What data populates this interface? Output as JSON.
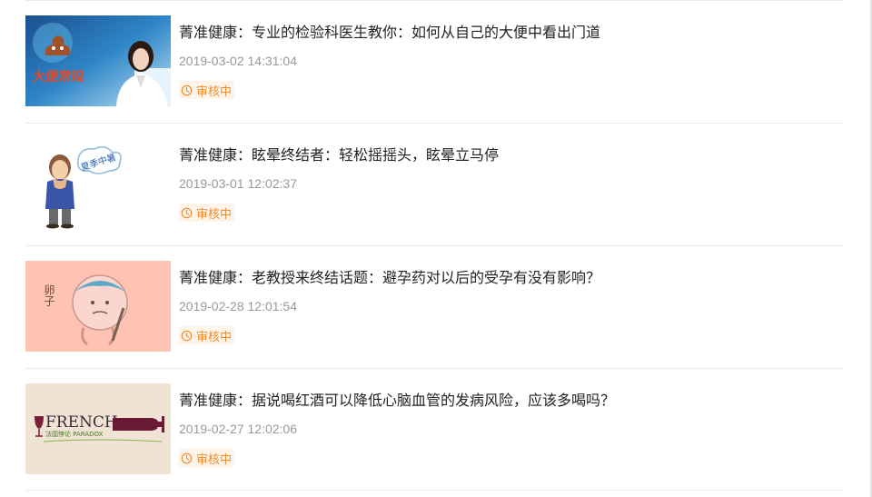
{
  "items": [
    {
      "thumb_text": "大便常规",
      "title": "菁准健康：专业的检验科医生教你：如何从自己的大便中看出门道",
      "date": "2019-03-02 14:31:04",
      "status": "审核中"
    },
    {
      "thumb_text": "夏季中暑",
      "title": "菁准健康：眩晕终结者：轻松摇摇头，眩晕立马停",
      "date": "2019-03-01 12:02:37",
      "status": "审核中"
    },
    {
      "thumb_text": "卵子",
      "title": "菁准健康：老教授来终结话题：避孕药对以后的受孕有没有影响？",
      "date": "2019-02-28 12:01:54",
      "status": "审核中"
    },
    {
      "thumb_text": "FRENCH",
      "thumb_subtext": "法国悖论 PARADOX",
      "title": "菁准健康：据说喝红酒可以降低心脑血管的发病风险，应该多喝吗？",
      "date": "2019-02-27 12:02:06",
      "status": "审核中"
    }
  ],
  "colors": {
    "status_text": "#f08c2c",
    "status_bg": "#fff4e9",
    "date": "#999999",
    "title": "#222222"
  }
}
